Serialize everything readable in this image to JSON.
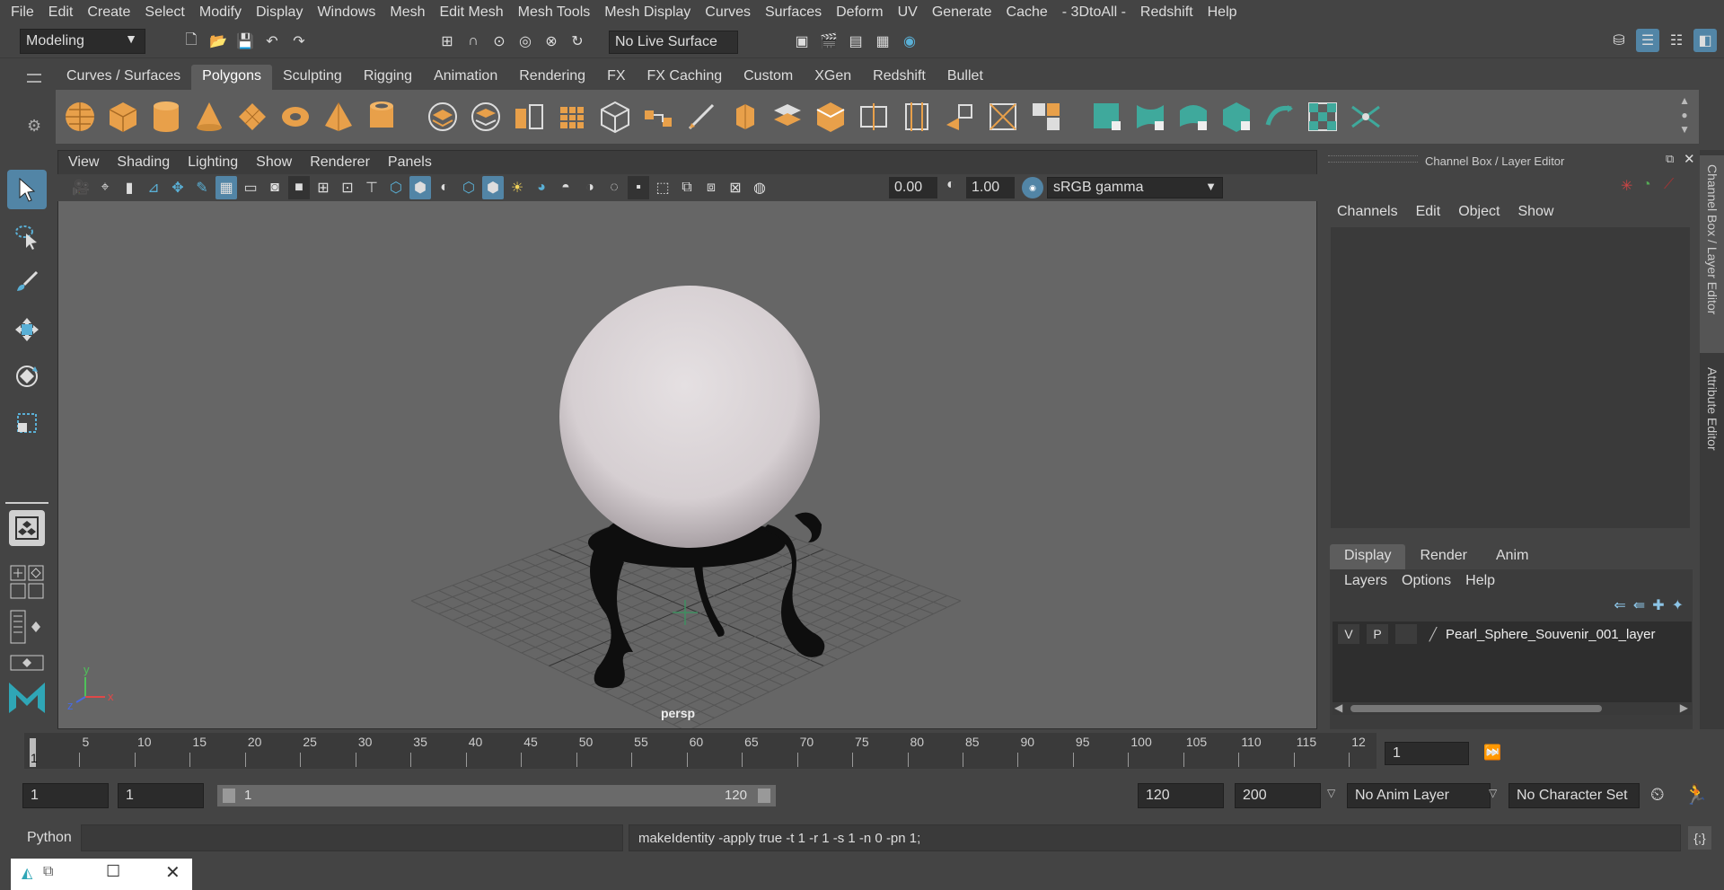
{
  "menubar": [
    "File",
    "Edit",
    "Create",
    "Select",
    "Modify",
    "Display",
    "Windows",
    "Mesh",
    "Edit Mesh",
    "Mesh Tools",
    "Mesh Display",
    "Curves",
    "Surfaces",
    "Deform",
    "UV",
    "Generate",
    "Cache",
    "- 3DtoAll -",
    "Redshift",
    "Help"
  ],
  "status": {
    "mode": "Modeling",
    "live_surface": "No Live Surface"
  },
  "shelf_tabs": [
    "Curves / Surfaces",
    "Polygons",
    "Sculpting",
    "Rigging",
    "Animation",
    "Rendering",
    "FX",
    "FX Caching",
    "Custom",
    "XGen",
    "Redshift",
    "Bullet"
  ],
  "shelf_active": "Polygons",
  "viewport": {
    "menu": [
      "View",
      "Shading",
      "Lighting",
      "Show",
      "Renderer",
      "Panels"
    ],
    "exposure": "0.00",
    "gamma": "1.00",
    "color_space": "sRGB gamma",
    "camera": "persp",
    "axis_x": "x",
    "axis_y": "y",
    "axis_z": "z"
  },
  "channel_box": {
    "title": "Channel Box / Layer Editor",
    "menu": [
      "Channels",
      "Edit",
      "Object",
      "Show"
    ]
  },
  "layer_editor": {
    "tabs": [
      "Display",
      "Render",
      "Anim"
    ],
    "menu": [
      "Layers",
      "Options",
      "Help"
    ],
    "layer": {
      "v": "V",
      "p": "P",
      "name": "Pearl_Sphere_Souvenir_001_layer"
    }
  },
  "side_tabs": [
    "Channel Box / Layer Editor",
    "Attribute Editor"
  ],
  "timeline": {
    "ticks": [
      "5",
      "10",
      "15",
      "20",
      "25",
      "30",
      "35",
      "40",
      "45",
      "50",
      "55",
      "60",
      "65",
      "70",
      "75",
      "80",
      "85",
      "90",
      "95",
      "100",
      "105",
      "110",
      "115",
      "12"
    ],
    "current_frame_marker": "1",
    "current_frame": "1"
  },
  "range": {
    "start": "1",
    "playback_start": "1",
    "slider_start": "1",
    "slider_end": "120",
    "playback_end": "120",
    "end": "200",
    "anim_layer": "No Anim Layer",
    "char_set": "No Character Set"
  },
  "cmdline": {
    "language": "Python",
    "result": "makeIdentity -apply true -t 1 -r 1 -s 1 -n 0 -pn 1;"
  },
  "colors": {
    "accent": "#e8a04a",
    "shelf_bg": "#5d5d5d",
    "viewport_bg": "#666666",
    "active_blue": "#5285a6",
    "teal": "#3fa99c"
  }
}
